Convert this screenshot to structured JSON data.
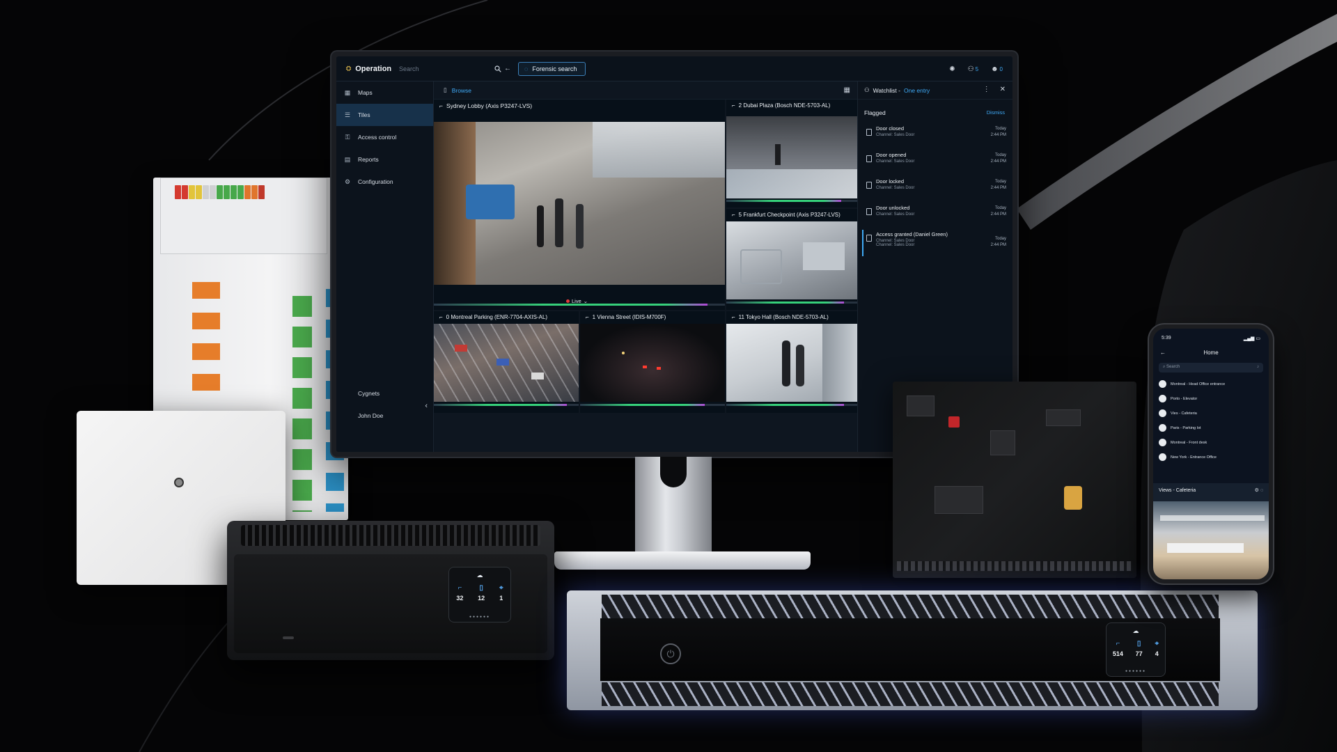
{
  "app": {
    "title": "Operation",
    "search_label": "Search",
    "forensic_label": "Forensic search",
    "badge_count_1": "5",
    "badge_count_2": "0"
  },
  "sidebar": {
    "items": [
      {
        "label": "Maps",
        "icon": "map-icon"
      },
      {
        "label": "Tiles",
        "icon": "tiles-icon"
      },
      {
        "label": "Access control",
        "icon": "access-control-icon"
      },
      {
        "label": "Reports",
        "icon": "reports-icon"
      },
      {
        "label": "Configuration",
        "icon": "configuration-icon"
      }
    ],
    "bottom": [
      {
        "label": "Cygnets"
      },
      {
        "label": "John Doe"
      }
    ]
  },
  "browse": {
    "label": "Browse"
  },
  "tiles": [
    {
      "title": "Sydney Lobby (Axis P3247-LVS)",
      "live_label": "Live"
    },
    {
      "title": "2 Dubai Plaza (Bosch NDE-5703-AL)"
    },
    {
      "title": "5 Frankfurt Checkpoint (Axis P3247-LVS)"
    },
    {
      "title": "0 Montreal Parking (ENR-7704-AXIS-AL)"
    },
    {
      "title": "1 Vienna Street (IDIS-M700F)"
    },
    {
      "title": "11 Tokyo Hall (Bosch NDE-5703-AL)"
    }
  ],
  "watchlist": {
    "title": "Watchlist -",
    "entry": "One entry",
    "flagged": "Flagged",
    "dismiss": "Dismiss",
    "events": [
      {
        "title": "Door closed",
        "channel": "Channel: Sales Door",
        "day": "Today",
        "time": "2:44 PM"
      },
      {
        "title": "Door opened",
        "channel": "Channel: Sales Door",
        "day": "Today",
        "time": "2:44 PM"
      },
      {
        "title": "Door locked",
        "channel": "Channel: Sales Door",
        "day": "Today",
        "time": "2:44 PM"
      },
      {
        "title": "Door unlocked",
        "channel": "Channel: Sales Door",
        "day": "Today",
        "time": "2:44 PM"
      },
      {
        "title": "Access granted (Daniel Green)",
        "channel": "Channel: Sales Door",
        "channel2": "Channel: Sales Door",
        "day": "Today",
        "time": "2:44 PM"
      }
    ]
  },
  "nvr_small": {
    "stats": [
      "32",
      "12",
      "1"
    ]
  },
  "nvr_rack": {
    "stats": [
      "514",
      "77",
      "4"
    ]
  },
  "phone": {
    "time": "5:39",
    "title": "Home",
    "search": "Search",
    "items": [
      "Montreal - Head Office entrance",
      "Porto - Elevator",
      "Vies - Cafeteria",
      "Paris - Parking lot",
      "Montreal - Front desk",
      "New York - Entrance Office"
    ],
    "views_title": "Views - Cafeteria"
  },
  "colors": {
    "accent": "#3fa9f5",
    "live_green": "#36d07a",
    "panel_bg": "#0e1620"
  }
}
